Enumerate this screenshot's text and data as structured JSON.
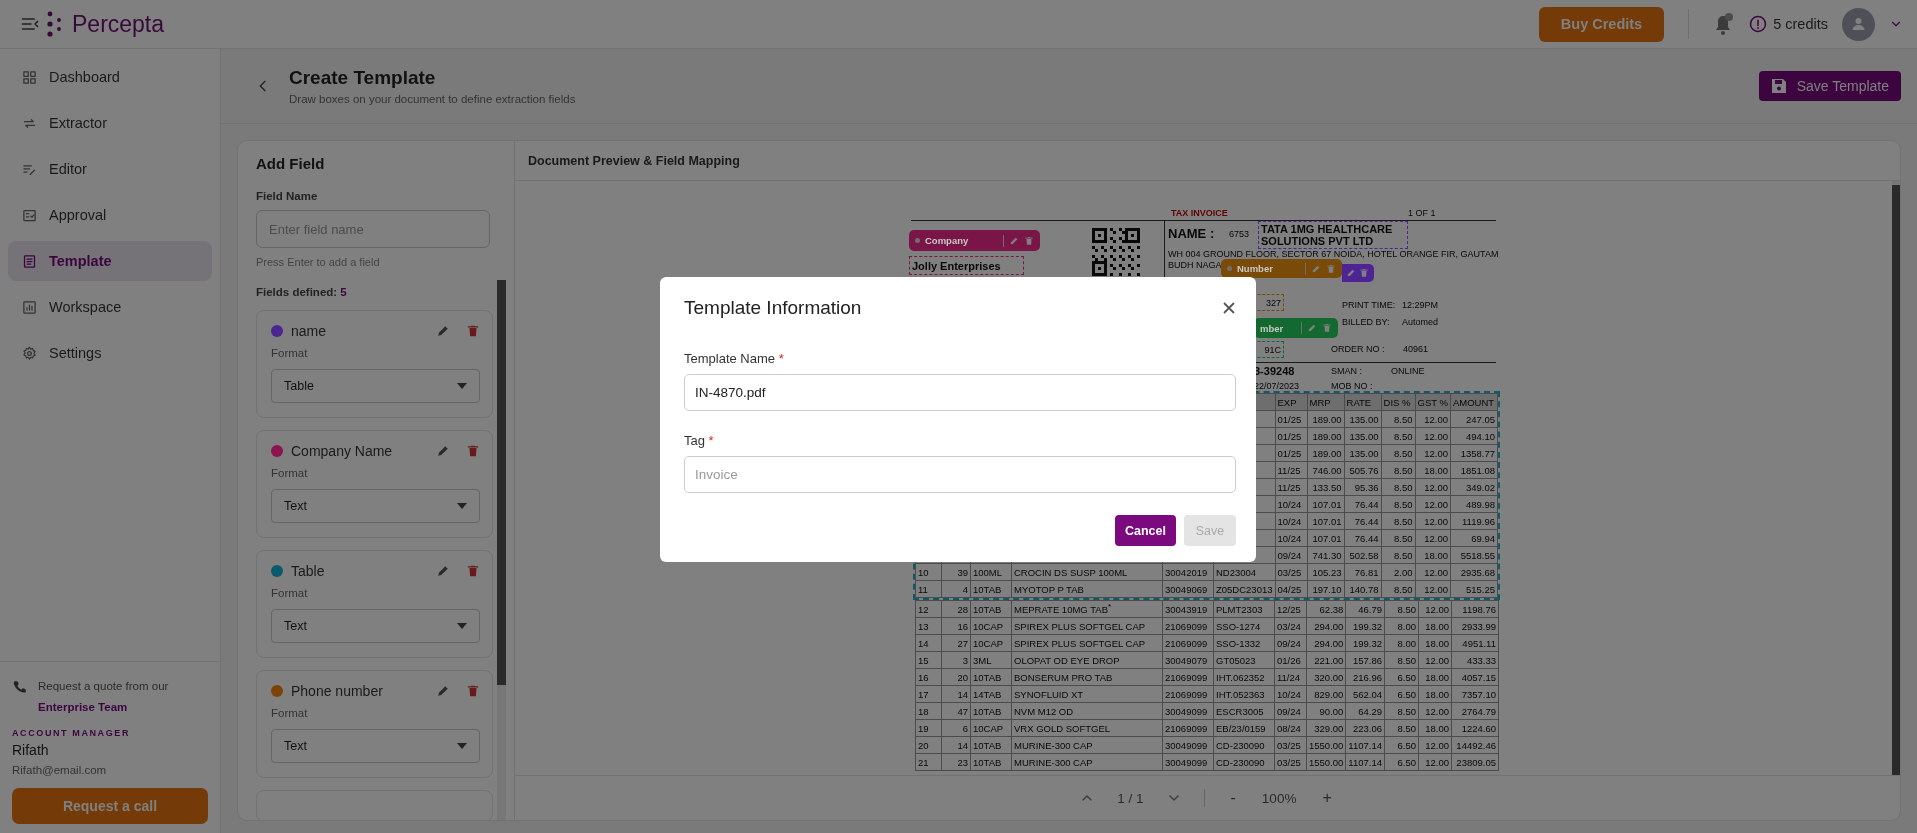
{
  "topbar": {
    "brand": "Percepta",
    "buy_button": "Buy Credits",
    "credits": "5 credits"
  },
  "sidebar": {
    "items": [
      {
        "label": "Dashboard",
        "selected": false
      },
      {
        "label": "Extractor",
        "selected": false
      },
      {
        "label": "Editor",
        "selected": false
      },
      {
        "label": "Approval",
        "selected": false
      },
      {
        "label": "Template",
        "selected": true
      },
      {
        "label": "Workspace",
        "selected": false
      },
      {
        "label": "Settings",
        "selected": false
      }
    ],
    "quote_text": "Request a quote from our",
    "quote_link": "Enterprise Team",
    "manager_label": "ACCOUNT MANAGER",
    "manager_name": "Rifath",
    "manager_email": "Rifath@email.com",
    "call_button": "Request a call"
  },
  "header": {
    "title": "Create Template",
    "subtitle": "Draw boxes on your document to define extraction fields",
    "save_button": "Save Template"
  },
  "add_field": {
    "title": "Add Field",
    "field_label": "Field Name",
    "placeholder": "Enter field name",
    "hint": "Press Enter to add a field",
    "count_label": "Fields defined:",
    "count": "5",
    "fields": [
      {
        "name": "name",
        "color": "#4b2590",
        "format_label": "Format",
        "format": "Table"
      },
      {
        "name": "Company Name",
        "color": "#8c1450",
        "format_label": "Format",
        "format": "Text"
      },
      {
        "name": "Table",
        "color": "#0b5a6b",
        "format_label": "Format",
        "format": "Text"
      },
      {
        "name": "Phone number",
        "color": "#7d4208",
        "format_label": "Format",
        "format": "Text"
      }
    ]
  },
  "preview": {
    "title": "Document Preview & Field Mapping",
    "document": {
      "title": "TAX INVOICE",
      "page_of": "1 OF  1",
      "name_label": "NAME :",
      "customer_code": "6753",
      "customer_name": "TATA 1MG HEALTHCARE SOLUTIONS PVT LTD",
      "address_line_1": "WH 004 GROUND FLOOR, SECTOR 67 NOIDA, HOTEL ORANGE FIR, GAUTAM",
      "address_line_2": "BUDH NAGA",
      "company_name": "Jolly Enterprises",
      "phone_partial": "327",
      "print_time_label": "PRINT TIME:",
      "print_time": "12:29PM",
      "billed_by_label": "BILLED BY:",
      "billed_by": "Automed",
      "gst_partial": "91C",
      "order_label": "ORDER NO  :",
      "order_no": "40961",
      "invoice_partial": "3-39248",
      "sman_label": "SMAN    :",
      "sman": "ONLINE",
      "date_partial": "22/07/2023",
      "mob_label": "MOB NO  :",
      "tags": [
        {
          "label": "Company",
          "color": "#7a1547"
        },
        {
          "color": "#4e2494"
        },
        {
          "label": "Number",
          "color": "#7a4a08"
        },
        {
          "label": "mber",
          "color": "#13692f"
        }
      ],
      "table_region": {
        "color": "#0e5a6a",
        "columns": [
          null,
          null,
          null,
          null,
          null,
          null,
          "EXP",
          "MRP",
          "RATE",
          "DIS %",
          "GST %",
          "AMOUNT"
        ],
        "rows": [
          {
            "cells": [
              null,
              null,
              null,
              null,
              null,
              null,
              "01/25",
              "189.00",
              "135.00",
              "8.50",
              "12.00",
              "247.05"
            ]
          },
          {
            "cells": [
              null,
              null,
              null,
              null,
              null,
              null,
              "01/25",
              "189.00",
              "135.00",
              "8.50",
              "12.00",
              "494.10"
            ]
          },
          {
            "cells": [
              null,
              null,
              null,
              null,
              null,
              null,
              "01/25",
              "189.00",
              "135.00",
              "8.50",
              "12.00",
              "1358.77"
            ]
          },
          {
            "cells": [
              null,
              null,
              null,
              null,
              null,
              null,
              "11/25",
              "746.00",
              "505.76",
              "8.50",
              "18.00",
              "1851.08"
            ]
          },
          {
            "cells": [
              null,
              null,
              null,
              null,
              null,
              null,
              "11/25",
              "133.50",
              "95.36",
              "8.50",
              "12.00",
              "349.02"
            ]
          },
          {
            "cells": [
              null,
              null,
              null,
              null,
              null,
              null,
              "10/24",
              "107.01",
              "76.44",
              "8.50",
              "12.00",
              "489.98"
            ]
          },
          {
            "cells": [
              null,
              null,
              null,
              null,
              null,
              null,
              "10/24",
              "107.01",
              "76.44",
              "8.50",
              "12.00",
              "1119.96"
            ]
          },
          {
            "cells": [
              null,
              null,
              null,
              null,
              null,
              null,
              "10/24",
              "107.01",
              "76.44",
              "8.50",
              "12.00",
              "69.94"
            ]
          },
          {
            "cells": [
              null,
              null,
              null,
              null,
              null,
              null,
              "09/24",
              "741.30",
              "502.58",
              "8.50",
              "18.00",
              "5518.55"
            ]
          },
          {
            "cells": [
              "10",
              "39",
              "100ML",
              "CROCIN DS SUSP 100ML",
              "30042019",
              "ND23004",
              "03/25",
              "105.23",
              "76.81",
              "2.00",
              "12.00",
              "2935.68"
            ]
          },
          {
            "cells": [
              "11",
              "4",
              "10TAB",
              "MYOTOP P TAB",
              "30049069",
              "Z05DC23013",
              "04/25",
              "197.10",
              "140.78",
              "8.50",
              "12.00",
              "515.25"
            ]
          }
        ]
      },
      "rows": [
        {
          "cells": [
            "12",
            "28",
            "10TAB",
            "MEPRATE 10MG TAB$^{*}$",
            "30043919",
            "PLMT2303",
            "12/25",
            "62.38",
            "46.79",
            "8.50",
            "12.00",
            "1198.76"
          ]
        },
        {
          "cells": [
            "13",
            "16",
            "10CAP",
            "SPIREX PLUS SOFTGEL CAP",
            "21069099",
            "SSO-1274",
            "03/24",
            "294.00",
            "199.32",
            "8.00",
            "18.00",
            "2933.99"
          ]
        },
        {
          "cells": [
            "14",
            "27",
            "10CAP",
            "SPIREX PLUS SOFTGEL CAP",
            "21069099",
            "SSO-1332",
            "09/24",
            "294.00",
            "199.32",
            "8.00",
            "18.00",
            "4951.11"
          ]
        },
        {
          "cells": [
            "15",
            "3",
            "3ML",
            "OLOPAT OD EYE DROP",
            "30049079",
            "GT05023",
            "01/26",
            "221.00",
            "157.86",
            "8.50",
            "12.00",
            "433.33"
          ]
        },
        {
          "cells": [
            "16",
            "20",
            "10TAB",
            "BONSERUM PRO TAB",
            "21069099",
            "IHT.062352",
            "11/24",
            "320.00",
            "216.96",
            "6.50",
            "18.00",
            "4057.15"
          ]
        },
        {
          "cells": [
            "17",
            "14",
            "14TAB",
            "SYNOFLUID XT",
            "21069099",
            "IHT.052363",
            "10/24",
            "829.00",
            "562.04",
            "6.50",
            "18.00",
            "7357.10"
          ]
        },
        {
          "cells": [
            "18",
            "47",
            "10TAB",
            "NVM  M12 OD",
            "30049099",
            "ESCR3005",
            "09/24",
            "90.00",
            "64.29",
            "8.50",
            "12.00",
            "2764.79"
          ]
        },
        {
          "cells": [
            "19",
            "6",
            "10CAP",
            "VRX GOLD SOFTGEL",
            "21069099",
            "EB/23/0159",
            "08/24",
            "329.00",
            "223.06",
            "8.50",
            "18.00",
            "1224.60"
          ]
        },
        {
          "cells": [
            "20",
            "14",
            "10TAB",
            "MURINE-300 CAP",
            "30049099",
            "CD-230090",
            "03/25",
            "1550.00",
            "1107.14",
            "6.50",
            "12.00",
            "14492.46"
          ]
        },
        {
          "cells": [
            "21",
            "23",
            "10TAB",
            "MURINE-300 CAP",
            "30049099",
            "CD-230090",
            "03/25",
            "1550.00",
            "1107.14",
            "6.50",
            "12.00",
            "23809.05"
          ]
        }
      ]
    },
    "pager": {
      "page": "1 / 1",
      "minus": "-",
      "zoom": "100%",
      "plus": "+"
    }
  },
  "modal": {
    "title": "Template Information",
    "name_label": "Template Name",
    "name_required": "*",
    "name_value": "IN-4870.pdf",
    "tag_label": "Tag",
    "tag_required": "*",
    "tag_placeholder": "Invoice",
    "cancel_button": "Cancel",
    "save_button": "Save",
    "save_disabled": true
  }
}
